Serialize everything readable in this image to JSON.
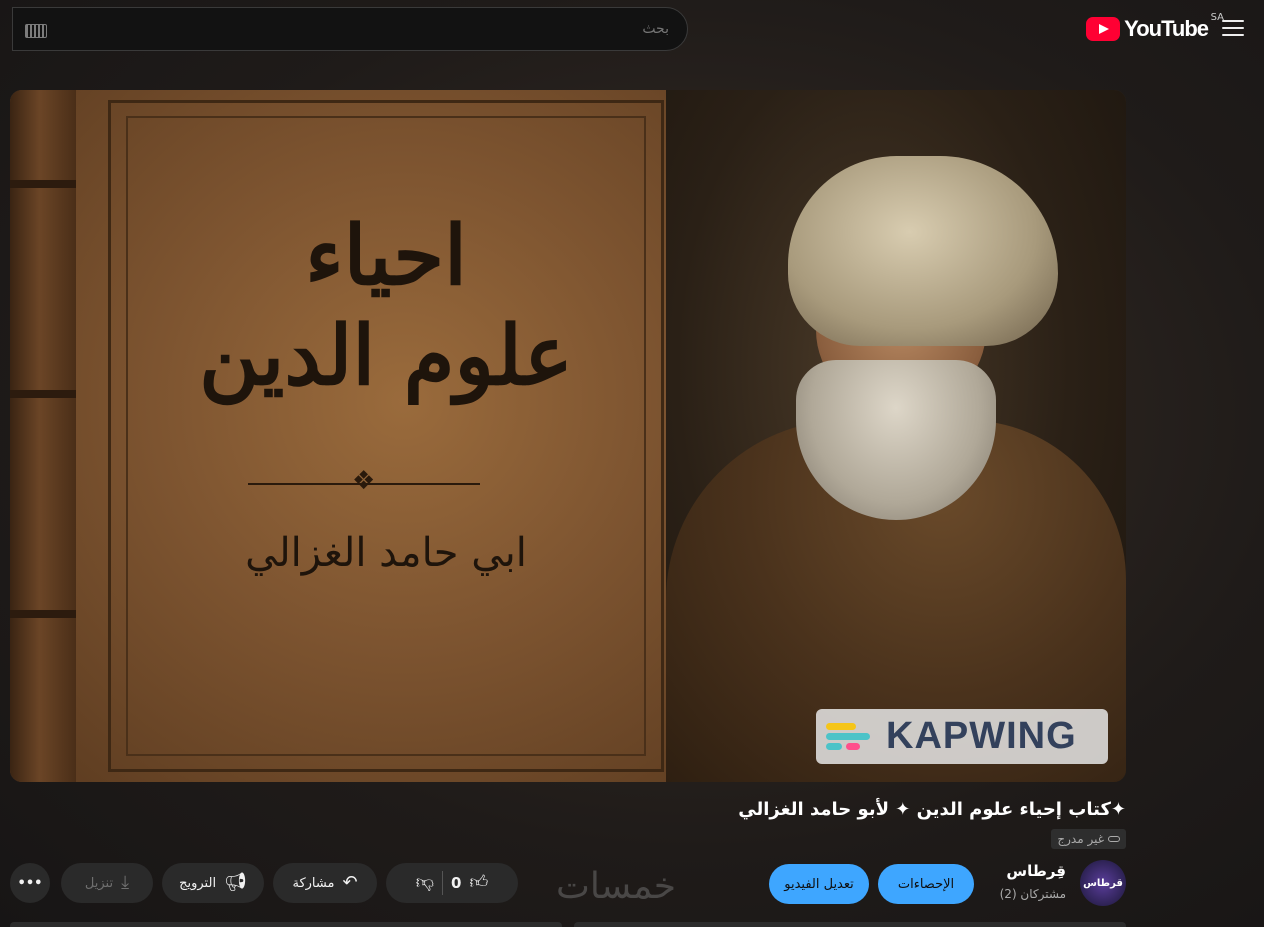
{
  "header": {
    "logo_text": "YouTube",
    "region_code": "SA",
    "search_placeholder": "بحث"
  },
  "player": {
    "cover_title_line1": "احياء",
    "cover_title_line2": "علوم الدين",
    "cover_author": "ابي حامد الغزالي",
    "watermark_text": "KAPWING"
  },
  "video": {
    "title": "✦كتاب إحياء علوم الدين ✦ لأبو حامد الغزالي",
    "visibility": "غير مدرج"
  },
  "channel": {
    "name": "قِرطاس",
    "subscribers": "مشتركان (2)",
    "avatar_text": "قرطاس"
  },
  "actions": {
    "analytics_label": "الإحصاءات",
    "edit_video_label": "تعديل الفيديو",
    "like_count": "0",
    "share_label": "مشاركة",
    "promote_label": "الترويج",
    "download_label": "تنزيل",
    "more_label": "•••"
  },
  "overlay": {
    "site_watermark": "خمسات"
  },
  "colors": {
    "brand_red": "#ff0033",
    "accent_blue": "#3ea6ff"
  }
}
